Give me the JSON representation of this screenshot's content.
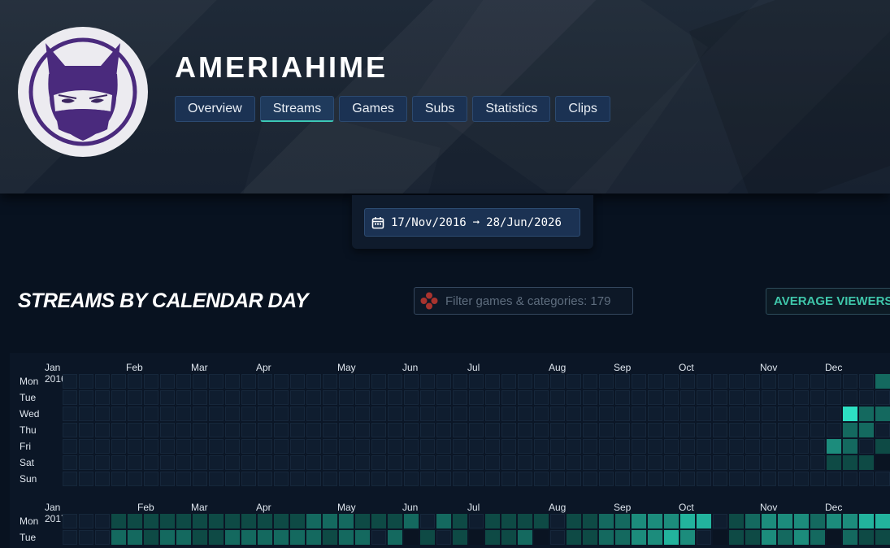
{
  "channel": {
    "name": "AMERIAHIME",
    "avatar_icon": "ninja-cat-avatar-icon"
  },
  "tabs": [
    {
      "label": "Overview",
      "active": false
    },
    {
      "label": "Streams",
      "active": true
    },
    {
      "label": "Games",
      "active": false
    },
    {
      "label": "Subs",
      "active": false
    },
    {
      "label": "Statistics",
      "active": false
    },
    {
      "label": "Clips",
      "active": false
    }
  ],
  "date_range": {
    "icon": "calendar-icon",
    "start": "17/Nov/2016",
    "arrow": "➞",
    "end": "28/Jun/2026"
  },
  "section": {
    "title": "STREAMS BY CALENDAR DAY",
    "filter_placeholder": "Filter games & categories: 179",
    "filter_icon": "gamepad-icon",
    "metric_button": "AVERAGE VIEWERS"
  },
  "colors": {
    "accent": "#3cc7b5",
    "empty_cell": "#0f1d2f",
    "empty_border": "#16273b",
    "no_stream": "#0a1422",
    "levels": [
      "#0e4a45",
      "#14695f",
      "#1c8c7c",
      "#22b39d",
      "#2de0c3"
    ]
  },
  "calendar": {
    "day_labels": [
      "Mon",
      "Tue",
      "Wed",
      "Thu",
      "Fri",
      "Sat",
      "Sun"
    ],
    "years": [
      {
        "year_label": "Jan 2016",
        "months": [
          "Feb",
          "Mar",
          "Apr",
          "May",
          "Jun",
          "Jul",
          "Aug",
          "Sep",
          "Oct",
          "Nov",
          "Dec"
        ],
        "rows": [
          "..................................................24.",
          "...................................................5",
          "................................................522.",
          "................................................22.1",
          "...............................................32.12",
          "...............................................1110.",
          "....................................................."
        ]
      },
      {
        "year_label": "Jan 2017",
        "months": [
          "Feb",
          "Mar",
          "Apr",
          "May",
          "Jun",
          "Jul",
          "Aug",
          "Sep",
          "Oct",
          "Nov",
          "Dec"
        ],
        "rows": [
          "...1111111111112221112.21.1111.112233344.123332334433",
          "...2212211222222122.201.101120.11223343.011323202111"
        ]
      }
    ]
  }
}
